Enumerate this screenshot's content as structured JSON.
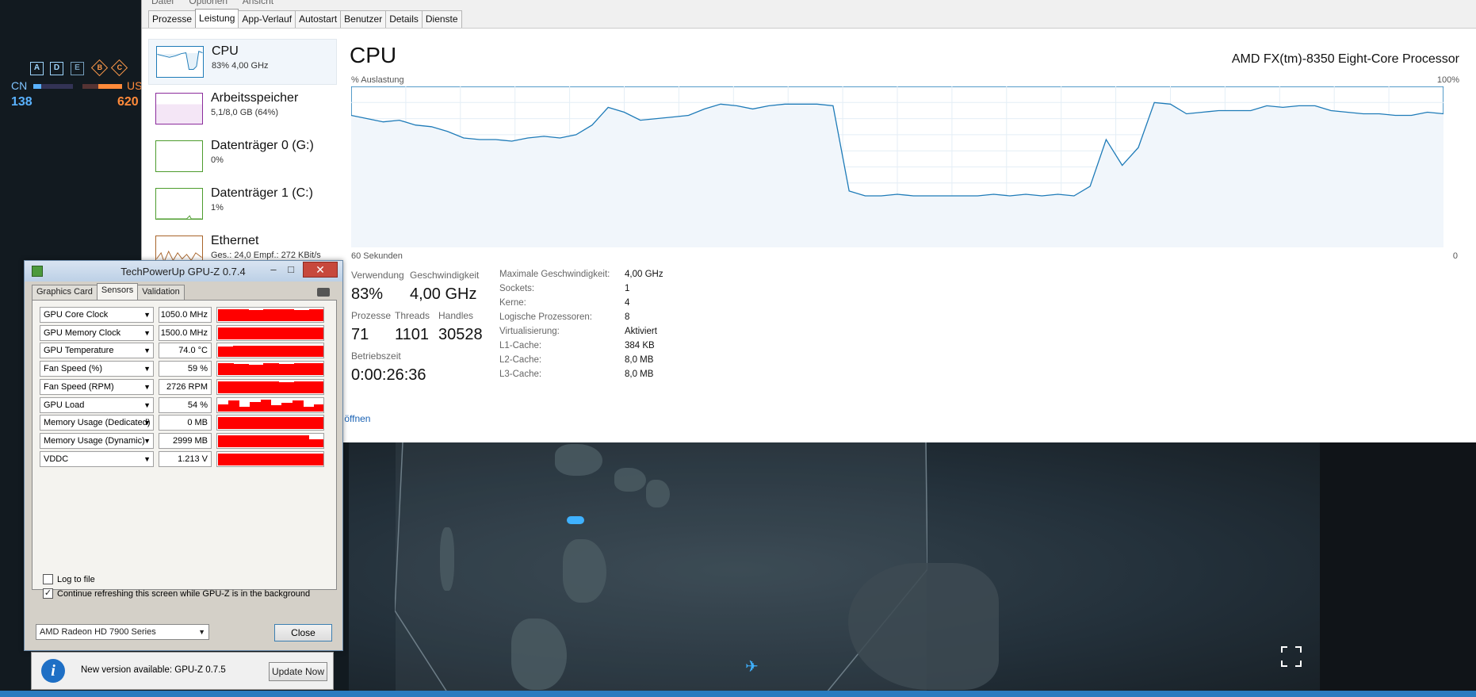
{
  "game": {
    "hud_squads": [
      "A",
      "D",
      "E"
    ],
    "hud_objectives": [
      "B",
      "C"
    ],
    "team_left": "CN",
    "team_right": "US",
    "score_left": "138",
    "score_right": "620"
  },
  "task_manager": {
    "menu": [
      "Datei",
      "Optionen",
      "Ansicht"
    ],
    "tabs": [
      "Prozesse",
      "Leistung",
      "App-Verlauf",
      "Autostart",
      "Benutzer",
      "Details",
      "Dienste"
    ],
    "active_tab": "Leistung",
    "sidebar": [
      {
        "title": "CPU",
        "sub": "83% 4,00 GHz",
        "color": "#1e7bb8"
      },
      {
        "title": "Arbeitsspeicher",
        "sub": "5,1/8,0 GB (64%)",
        "color": "#8b2c9c"
      },
      {
        "title": "Datenträger 0 (G:)",
        "sub": "0%",
        "color": "#4d9c2d"
      },
      {
        "title": "Datenträger 1 (C:)",
        "sub": "1%",
        "color": "#4d9c2d"
      },
      {
        "title": "Ethernet",
        "sub": "Ges.: 24,0  Empf.: 272 KBit/s",
        "color": "#a8642a"
      }
    ],
    "cpu": {
      "title": "CPU",
      "model": "AMD FX(tm)-8350 Eight-Core Processor",
      "util_label": "% Auslastung",
      "max_label": "100%",
      "time_label": "60 Sekunden",
      "min_label": "0",
      "stats": {
        "usage_label": "Verwendung",
        "usage": "83%",
        "speed_label": "Geschwindigkeit",
        "speed": "4,00 GHz",
        "proc_label": "Prozesse",
        "proc": "71",
        "threads_label": "Threads",
        "threads": "1101",
        "handles_label": "Handles",
        "handles": "30528",
        "uptime_label": "Betriebszeit",
        "uptime": "0:00:26:36"
      },
      "specs": [
        {
          "label": "Maximale Geschwindigkeit:",
          "value": "4,00 GHz"
        },
        {
          "label": "Sockets:",
          "value": "1"
        },
        {
          "label": "Kerne:",
          "value": "4"
        },
        {
          "label": "Logische Prozessoren:",
          "value": "8"
        },
        {
          "label": "Virtualisierung:",
          "value": "Aktiviert"
        },
        {
          "label": "L1-Cache:",
          "value": "384 KB"
        },
        {
          "label": "L2-Cache:",
          "value": "8,0 MB"
        },
        {
          "label": "L3-Cache:",
          "value": "8,0 MB"
        }
      ],
      "open_link": "r öffnen",
      "history_percent": [
        82,
        80,
        78,
        79,
        76,
        75,
        72,
        68,
        67,
        67,
        66,
        68,
        69,
        68,
        70,
        76,
        87,
        84,
        79,
        80,
        81,
        82,
        86,
        89,
        88,
        86,
        88,
        89,
        89,
        89,
        88,
        35,
        32,
        32,
        33,
        32,
        32,
        32,
        32,
        32,
        33,
        32,
        33,
        32,
        33,
        32,
        38,
        67,
        51,
        62,
        90,
        89,
        83,
        84,
        85,
        85,
        85,
        88,
        87,
        88,
        88,
        85,
        84,
        83,
        83,
        82,
        82,
        84,
        83
      ]
    }
  },
  "gpuz": {
    "title": "TechPowerUp GPU-Z 0.7.4",
    "tabs": [
      "Graphics Card",
      "Sensors",
      "Validation"
    ],
    "active_tab": "Sensors",
    "sensors": [
      {
        "name": "GPU Core Clock",
        "value": "1050.0 MHz"
      },
      {
        "name": "GPU Memory Clock",
        "value": "1500.0 MHz"
      },
      {
        "name": "GPU Temperature",
        "value": "74.0 °C"
      },
      {
        "name": "Fan Speed (%)",
        "value": "59 %"
      },
      {
        "name": "Fan Speed (RPM)",
        "value": "2726 RPM"
      },
      {
        "name": "GPU Load",
        "value": "54 %"
      },
      {
        "name": "Memory Usage (Dedicated)",
        "value": "0 MB"
      },
      {
        "name": "Memory Usage (Dynamic)",
        "value": "2999 MB"
      },
      {
        "name": "VDDC",
        "value": "1.213 V"
      }
    ],
    "log_to_file": "Log to file",
    "continue_refresh": "Continue refreshing this screen while GPU-Z is in the background",
    "log_checked": false,
    "refresh_checked": true,
    "gpu_selected": "AMD Radeon HD 7900 Series",
    "close_label": "Close"
  },
  "notice": {
    "text": "New version available: GPU-Z 0.7.5",
    "button": "Update Now"
  }
}
